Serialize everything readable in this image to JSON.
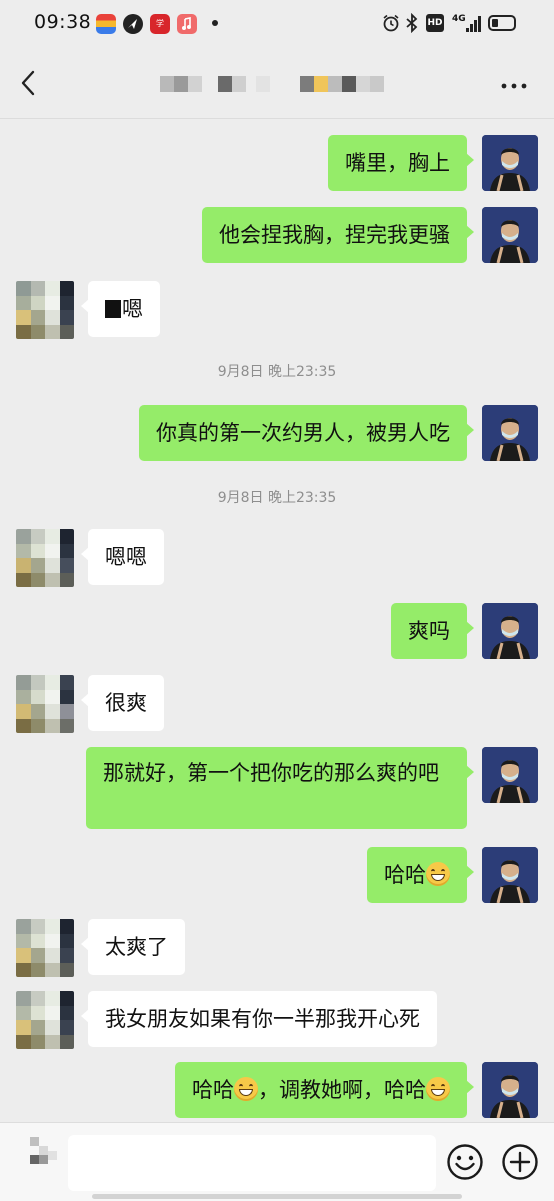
{
  "status_bar": {
    "time": "09:38",
    "app_icons": [
      "photos-icon",
      "maps-icon",
      "study-app-icon",
      "music-icon"
    ],
    "right_icons": [
      "alarm-icon",
      "bluetooth-icon",
      "hd-icon",
      "signal-icon",
      "battery-icon"
    ],
    "hd_label": "HD",
    "network_label": "4G"
  },
  "header": {
    "title_redacted": true,
    "back_icon": "chevron-left-icon",
    "more_icon": "more-icon"
  },
  "messages": [
    {
      "side": "me",
      "text": "嘴里，胸上"
    },
    {
      "side": "me",
      "text": "他会捏我胸，捏完我更骚"
    },
    {
      "side": "other",
      "text": "嗯",
      "redacted_prefix": true
    },
    {
      "type": "time",
      "text": "9月8日 晚上23:35"
    },
    {
      "side": "me",
      "text": "你真的第一次约男人，被男人吃"
    },
    {
      "type": "time",
      "text": "9月8日 晚上23:35"
    },
    {
      "side": "other",
      "text": "嗯嗯"
    },
    {
      "side": "me",
      "text": "爽吗"
    },
    {
      "side": "other",
      "text": "很爽"
    },
    {
      "side": "me",
      "text": "那就好，第一个把你吃的那么爽的吧"
    },
    {
      "side": "me",
      "text": "哈哈",
      "emoji": "grin-emoji"
    },
    {
      "side": "other",
      "text": "太爽了"
    },
    {
      "side": "other",
      "text": "我女朋友如果有你一半那我开心死"
    },
    {
      "side": "me",
      "text_a": "哈哈",
      "text_b": "，调教她啊，哈哈",
      "emoji": "grin-emoji"
    }
  ],
  "input_bar": {
    "placeholder": "",
    "emoji_button_icon": "smile-icon",
    "plus_button_icon": "plus-icon"
  },
  "colors": {
    "background": "#ededed",
    "my_bubble": "#95ec69",
    "other_bubble": "#ffffff",
    "timestamp": "#8e8e8e",
    "my_avatar_bg": "#2c3d78"
  }
}
